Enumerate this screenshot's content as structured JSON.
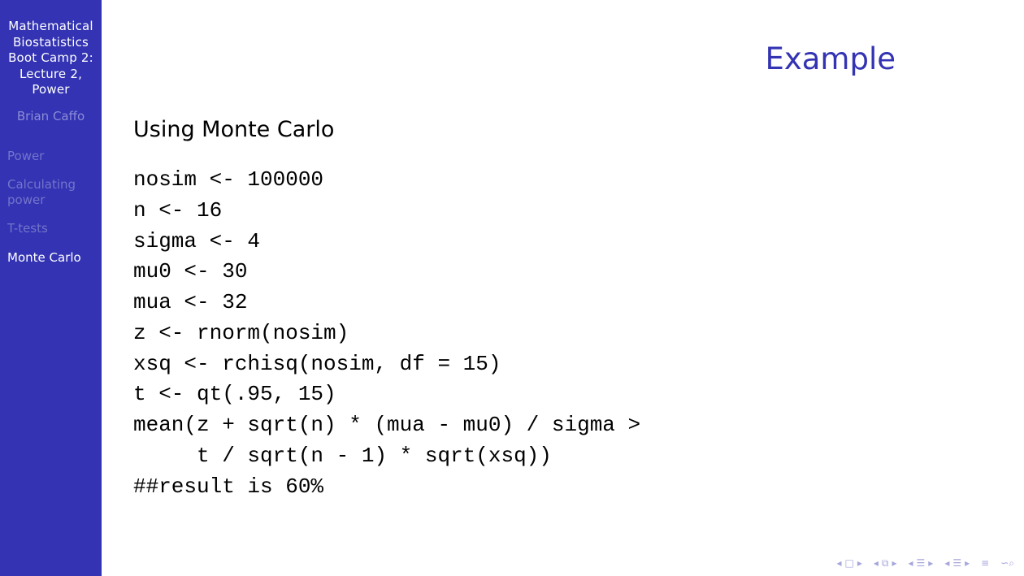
{
  "sidebar": {
    "title_lines": [
      "Mathematical",
      "Biostatistics",
      "Boot Camp 2:",
      "Lecture 2,",
      "Power"
    ],
    "author": "Brian Caffo",
    "items": [
      {
        "label": "Power"
      },
      {
        "label_lines": [
          "Calculating",
          "power"
        ]
      },
      {
        "label": "T-tests"
      },
      {
        "label": "Monte Carlo",
        "active": true
      }
    ]
  },
  "slide": {
    "title": "Example",
    "subtitle": "Using Monte Carlo",
    "code": [
      "nosim <- 100000",
      "n <- 16",
      "sigma <- 4",
      "mu0 <- 30",
      "mua <- 32",
      "z <- rnorm(nosim)",
      "xsq <- rchisq(nosim, df = 15)",
      "t <- qt(.95, 15)",
      "mean(z + sqrt(n) * (mua - mu0) / sigma >",
      "     t / sqrt(n - 1) * sqrt(xsq))",
      "##result is 60%"
    ]
  },
  "colors": {
    "sidebar_bg": "#3333b3",
    "title": "#3333b3",
    "sidebar_inactive": "#7474cc",
    "nav": "#a5a5dc"
  },
  "nav_icons": [
    "nav-left-icon",
    "frame-icon",
    "nav-right-icon",
    "nav-left-icon",
    "subsection-icon",
    "nav-right-icon",
    "nav-left-icon",
    "section-icon",
    "nav-right-icon",
    "nav-left-icon",
    "doc-icon",
    "nav-right-icon",
    "align-icon",
    "search-icon"
  ]
}
